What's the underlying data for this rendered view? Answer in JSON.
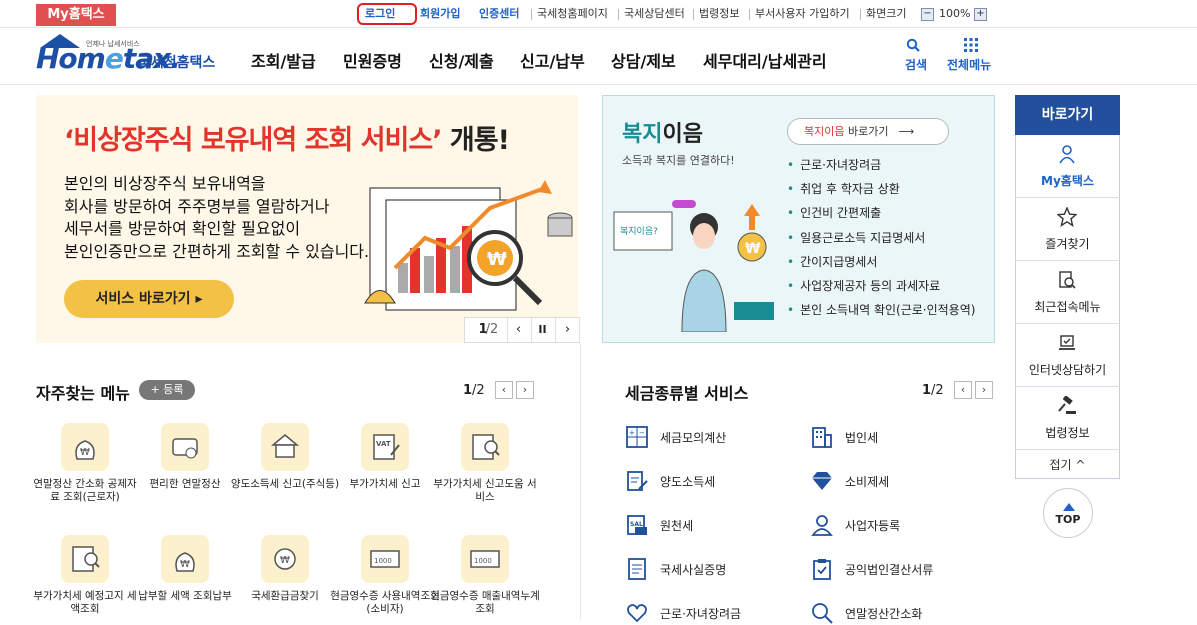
{
  "topbar": {
    "myhome_tab": "My홈택스",
    "login": "로그인",
    "signup": "회원가입",
    "auth_center": "인증센터",
    "nts_page": "국세청홈페이지",
    "counsel_center": "국세상담센터",
    "law_info": "법령정보",
    "dept_user_join": "부서사용자 가입하기",
    "screen_size_label": "화면크기",
    "zoom_minus": "−",
    "zoom_value": "100%",
    "zoom_plus": "+"
  },
  "header": {
    "logo_small": "언제나 납세서비스",
    "logo_main_left": "Hom",
    "logo_main_e": "e",
    "logo_main_right": "tax.",
    "logo_sub": "국세청홈택스",
    "nav": [
      "조회/발급",
      "민원증명",
      "신청/제출",
      "신고/납부",
      "상담/제보",
      "세무대리/납세관리"
    ],
    "search_label": "검색",
    "all_menu_label": "전체메뉴"
  },
  "banner": {
    "title_red": "‘비상장주식 보유내역 조회 서비스’",
    "title_rest": " 개통!",
    "body_lines": [
      "본인의 비상장주식 보유내역을",
      "회사를 방문하여 주주명부를 열람하거나",
      "세무서를 방문하여 확인할 필요없이",
      "본인인증만으로 간편하게 조회할 수 있습니다."
    ],
    "button": "서비스 바로가기 ▸",
    "page_current": "1",
    "page_total": "/2",
    "prev": "‹",
    "pause": "II",
    "next": "›"
  },
  "welfare": {
    "title_accent": "복지",
    "title_rest": "이음",
    "subtitle": "소득과 복지를 연결하다!",
    "link_accent": "복지이음",
    "link_rest": " 바로가기",
    "bubble_text": "복지이음?",
    "items": [
      "근로·자녀장려금",
      "취업 후 학자금 상환",
      "인건비 간편제출",
      "일용근로소득 지급명세서",
      "간이지급명세서",
      "사업장제공자 등의 과세자료",
      "본인 소득내역 확인(근로·인적용역)"
    ]
  },
  "sidebar": {
    "header": "바로가기",
    "items": [
      "My홈택스",
      "즐겨찾기",
      "최근접속메뉴",
      "인터넷상담하기",
      "법령정보"
    ],
    "fold": "접기 ^",
    "top": "TOP",
    "accent_color": "#23509c"
  },
  "frequent_menu": {
    "title": "자주찾는 메뉴",
    "register": "+ 등록",
    "page_current": "1",
    "page_total": "/2",
    "prev": "‹",
    "next": "›",
    "items": [
      {
        "label": "연말정산 간소화 공제자료 조회(근로자)",
        "icon": "bag-icon"
      },
      {
        "label": "편리한 연말정산",
        "icon": "card-icon"
      },
      {
        "label": "양도소득세 신고(주식등)",
        "icon": "house-icon"
      },
      {
        "label": "부가가치세 신고",
        "icon": "vat-icon"
      },
      {
        "label": "부가가치세 신고도움 서비스",
        "icon": "search-doc-icon"
      },
      {
        "label": "부가가치세 예정고지 세액조회",
        "icon": "search-doc-icon"
      },
      {
        "label": "납부할 세액 조회납부",
        "icon": "bag-icon"
      },
      {
        "label": "국세환급금찾기",
        "icon": "refund-icon"
      },
      {
        "label": "현금영수증 사용내역조회(소비자)",
        "icon": "receipt-icon"
      },
      {
        "label": "현금영수증 매출내역누계 조회",
        "icon": "receipt-icon"
      }
    ]
  },
  "tax_services": {
    "title": "세금종류별 서비스",
    "page_current": "1",
    "page_total": "/2",
    "prev": "‹",
    "next": "›",
    "items": [
      {
        "label": "세금모의계산",
        "icon": "calculator-icon"
      },
      {
        "label": "법인세",
        "icon": "building-icon"
      },
      {
        "label": "양도소득세",
        "icon": "document-pen-icon"
      },
      {
        "label": "소비제세",
        "icon": "diamond-icon"
      },
      {
        "label": "원천세",
        "icon": "salary-icon"
      },
      {
        "label": "사업자등록",
        "icon": "person-icon"
      },
      {
        "label": "국세사실증명",
        "icon": "document-icon"
      },
      {
        "label": "공익법인결산서류",
        "icon": "clipboard-icon"
      },
      {
        "label": "근로·자녀장려금",
        "icon": "heart-hand-icon"
      },
      {
        "label": "연말정산간소화",
        "icon": "search-person-icon"
      }
    ]
  }
}
